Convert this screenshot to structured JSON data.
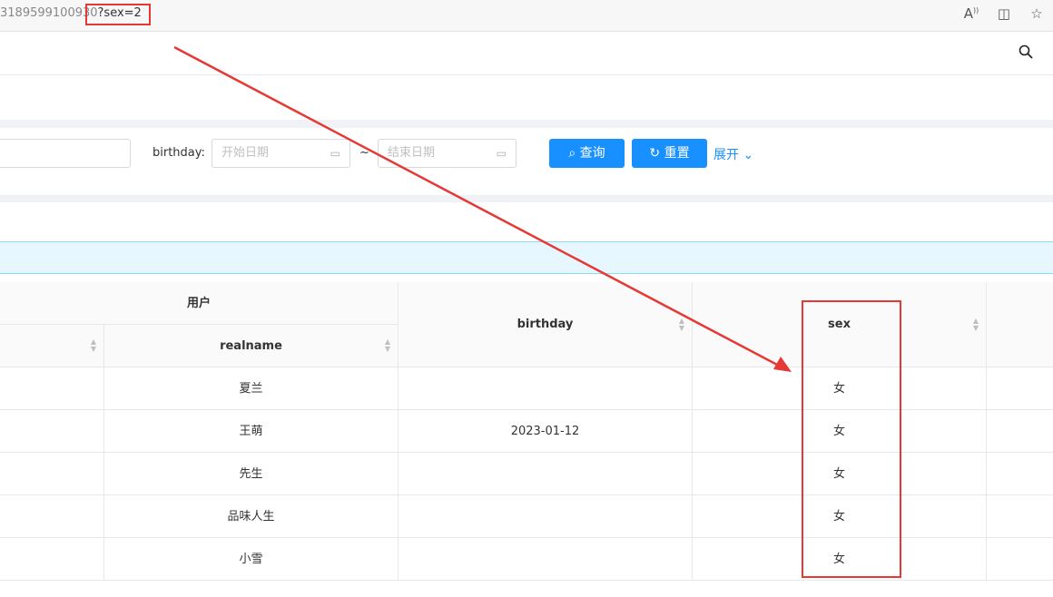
{
  "browser": {
    "url_prefix": "3189599100930",
    "url_query": "?sex=2",
    "icons": [
      "read-aloud-icon",
      "split-screen-icon",
      "favorites-icon"
    ]
  },
  "header": {
    "icon": "search-icon"
  },
  "query": {
    "birthday_label": "birthday:",
    "start_placeholder": "开始日期",
    "end_placeholder": "结束日期",
    "range_separator": "~",
    "search_button": "查询",
    "reset_button": "重置",
    "expand_link": "展开"
  },
  "table": {
    "group_header": "用户",
    "columns": {
      "realname": "realname",
      "birthday": "birthday",
      "sex": "sex"
    },
    "rows": [
      {
        "realname": "夏兰",
        "birthday": "",
        "sex": "女"
      },
      {
        "realname": "王萌",
        "birthday": "2023-01-12",
        "sex": "女"
      },
      {
        "realname": "先生",
        "birthday": "",
        "sex": "女"
      },
      {
        "realname": "品味人生",
        "birthday": "",
        "sex": "女"
      },
      {
        "realname": "小雪",
        "birthday": "",
        "sex": "女"
      }
    ]
  },
  "annotation": {
    "color": "#e53935"
  }
}
